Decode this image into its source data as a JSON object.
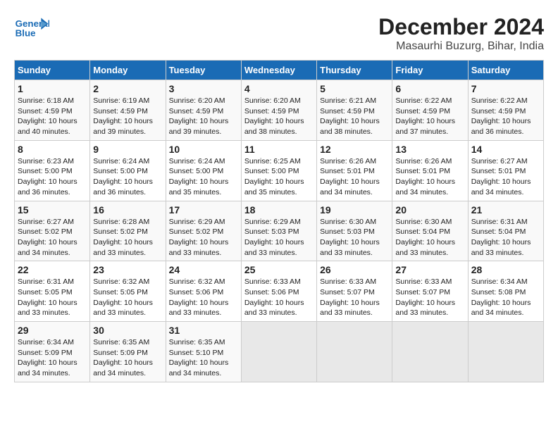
{
  "logo": {
    "line1": "General",
    "line2": "Blue"
  },
  "title": "December 2024",
  "subtitle": "Masaurhi Buzurg, Bihar, India",
  "days_of_week": [
    "Sunday",
    "Monday",
    "Tuesday",
    "Wednesday",
    "Thursday",
    "Friday",
    "Saturday"
  ],
  "weeks": [
    [
      {
        "day": "1",
        "sunrise": "6:18 AM",
        "sunset": "4:59 PM",
        "daylight": "10 hours and 40 minutes."
      },
      {
        "day": "2",
        "sunrise": "6:19 AM",
        "sunset": "4:59 PM",
        "daylight": "10 hours and 39 minutes."
      },
      {
        "day": "3",
        "sunrise": "6:20 AM",
        "sunset": "4:59 PM",
        "daylight": "10 hours and 39 minutes."
      },
      {
        "day": "4",
        "sunrise": "6:20 AM",
        "sunset": "4:59 PM",
        "daylight": "10 hours and 38 minutes."
      },
      {
        "day": "5",
        "sunrise": "6:21 AM",
        "sunset": "4:59 PM",
        "daylight": "10 hours and 38 minutes."
      },
      {
        "day": "6",
        "sunrise": "6:22 AM",
        "sunset": "4:59 PM",
        "daylight": "10 hours and 37 minutes."
      },
      {
        "day": "7",
        "sunrise": "6:22 AM",
        "sunset": "4:59 PM",
        "daylight": "10 hours and 36 minutes."
      }
    ],
    [
      {
        "day": "8",
        "sunrise": "6:23 AM",
        "sunset": "5:00 PM",
        "daylight": "10 hours and 36 minutes."
      },
      {
        "day": "9",
        "sunrise": "6:24 AM",
        "sunset": "5:00 PM",
        "daylight": "10 hours and 36 minutes."
      },
      {
        "day": "10",
        "sunrise": "6:24 AM",
        "sunset": "5:00 PM",
        "daylight": "10 hours and 35 minutes."
      },
      {
        "day": "11",
        "sunrise": "6:25 AM",
        "sunset": "5:00 PM",
        "daylight": "10 hours and 35 minutes."
      },
      {
        "day": "12",
        "sunrise": "6:26 AM",
        "sunset": "5:01 PM",
        "daylight": "10 hours and 34 minutes."
      },
      {
        "day": "13",
        "sunrise": "6:26 AM",
        "sunset": "5:01 PM",
        "daylight": "10 hours and 34 minutes."
      },
      {
        "day": "14",
        "sunrise": "6:27 AM",
        "sunset": "5:01 PM",
        "daylight": "10 hours and 34 minutes."
      }
    ],
    [
      {
        "day": "15",
        "sunrise": "6:27 AM",
        "sunset": "5:02 PM",
        "daylight": "10 hours and 34 minutes."
      },
      {
        "day": "16",
        "sunrise": "6:28 AM",
        "sunset": "5:02 PM",
        "daylight": "10 hours and 33 minutes."
      },
      {
        "day": "17",
        "sunrise": "6:29 AM",
        "sunset": "5:02 PM",
        "daylight": "10 hours and 33 minutes."
      },
      {
        "day": "18",
        "sunrise": "6:29 AM",
        "sunset": "5:03 PM",
        "daylight": "10 hours and 33 minutes."
      },
      {
        "day": "19",
        "sunrise": "6:30 AM",
        "sunset": "5:03 PM",
        "daylight": "10 hours and 33 minutes."
      },
      {
        "day": "20",
        "sunrise": "6:30 AM",
        "sunset": "5:04 PM",
        "daylight": "10 hours and 33 minutes."
      },
      {
        "day": "21",
        "sunrise": "6:31 AM",
        "sunset": "5:04 PM",
        "daylight": "10 hours and 33 minutes."
      }
    ],
    [
      {
        "day": "22",
        "sunrise": "6:31 AM",
        "sunset": "5:05 PM",
        "daylight": "10 hours and 33 minutes."
      },
      {
        "day": "23",
        "sunrise": "6:32 AM",
        "sunset": "5:05 PM",
        "daylight": "10 hours and 33 minutes."
      },
      {
        "day": "24",
        "sunrise": "6:32 AM",
        "sunset": "5:06 PM",
        "daylight": "10 hours and 33 minutes."
      },
      {
        "day": "25",
        "sunrise": "6:33 AM",
        "sunset": "5:06 PM",
        "daylight": "10 hours and 33 minutes."
      },
      {
        "day": "26",
        "sunrise": "6:33 AM",
        "sunset": "5:07 PM",
        "daylight": "10 hours and 33 minutes."
      },
      {
        "day": "27",
        "sunrise": "6:33 AM",
        "sunset": "5:07 PM",
        "daylight": "10 hours and 33 minutes."
      },
      {
        "day": "28",
        "sunrise": "6:34 AM",
        "sunset": "5:08 PM",
        "daylight": "10 hours and 34 minutes."
      }
    ],
    [
      {
        "day": "29",
        "sunrise": "6:34 AM",
        "sunset": "5:09 PM",
        "daylight": "10 hours and 34 minutes."
      },
      {
        "day": "30",
        "sunrise": "6:35 AM",
        "sunset": "5:09 PM",
        "daylight": "10 hours and 34 minutes."
      },
      {
        "day": "31",
        "sunrise": "6:35 AM",
        "sunset": "5:10 PM",
        "daylight": "10 hours and 34 minutes."
      },
      null,
      null,
      null,
      null
    ]
  ],
  "labels": {
    "sunrise": "Sunrise:",
    "sunset": "Sunset:",
    "daylight": "Daylight:"
  }
}
